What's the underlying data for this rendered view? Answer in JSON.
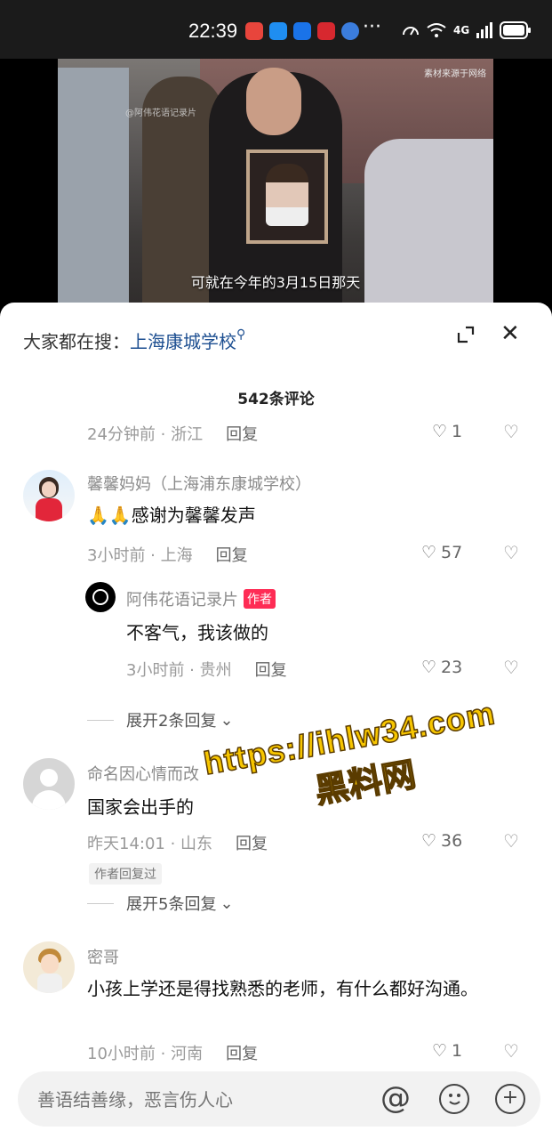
{
  "status": {
    "time": "22:39",
    "dots": "···",
    "network": "4G"
  },
  "video": {
    "watermark": "素材来源于网络",
    "small": "@阿伟花语记录片",
    "subtitle": "可就在今年的3月15日那天"
  },
  "header": {
    "search_prefix": "大家都在搜：",
    "search_keyword": "上海康城学校",
    "count": "542条评论"
  },
  "comments": [
    {
      "time": "24分钟前 · 浙江",
      "reply": "回复",
      "likes": "1"
    },
    {
      "user": "馨馨妈妈（上海浦东康城学校）",
      "text": "🙏🙏感谢为馨馨发声",
      "time": "3小时前 · 上海",
      "reply": "回复",
      "likes": "57",
      "sub": {
        "user": "阿伟花语记录片",
        "badge": "作者",
        "text": "不客气，我该做的",
        "time": "3小时前 · 贵州",
        "reply": "回复",
        "likes": "23"
      },
      "expand": "展开2条回复"
    },
    {
      "user": "命名因心情而改",
      "text": "国家会出手的",
      "time": "昨天14:01 · 山东",
      "reply": "回复",
      "likes": "36",
      "author_replied": "作者回复过",
      "expand": "展开5条回复"
    },
    {
      "user": "密哥",
      "text": "小孩上学还是得找熟悉的老师，有什么都好沟通。",
      "time": "10小时前 · 河南",
      "reply": "回复",
      "likes": "1"
    }
  ],
  "input": {
    "placeholder": "善语结善缘，恶言伤人心"
  },
  "overlay_watermark": {
    "url": "https://ihlw34.com",
    "site": "黑料网"
  }
}
